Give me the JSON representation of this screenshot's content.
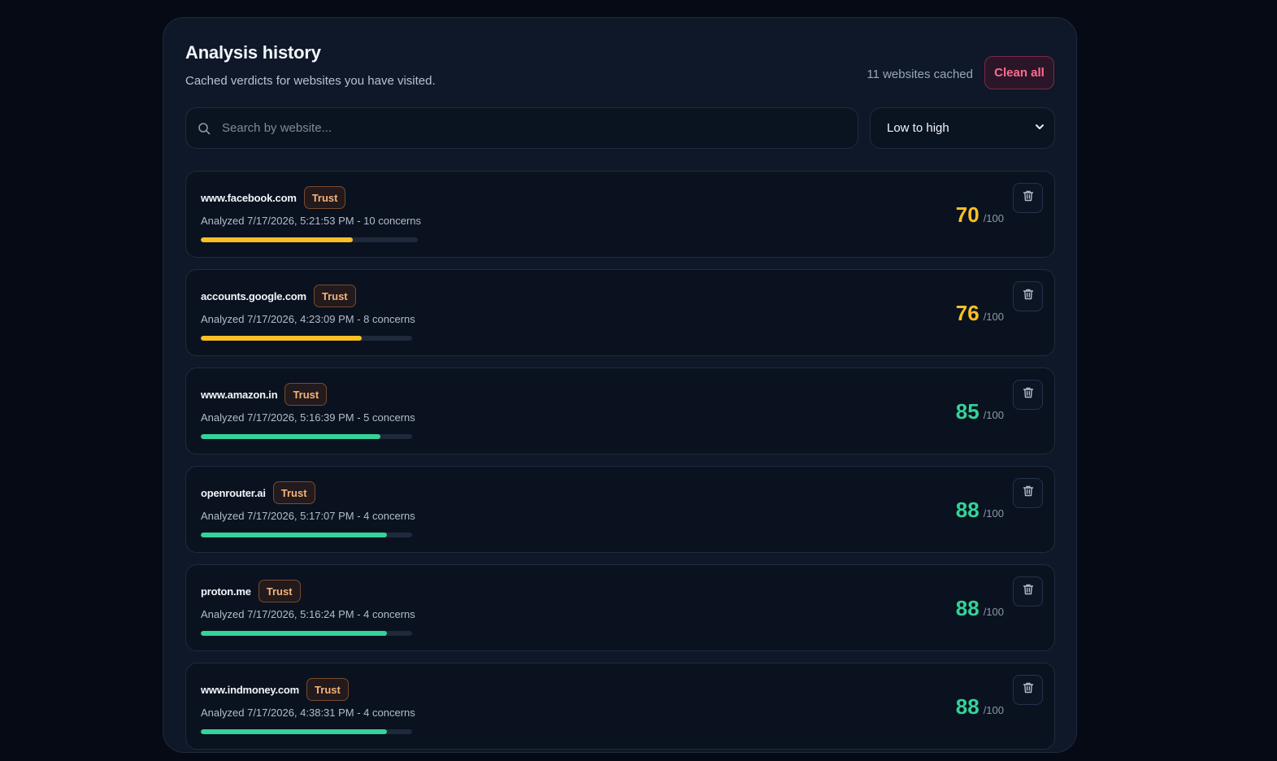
{
  "header": {
    "title": "Analysis history",
    "subtitle": "Cached verdicts for websites you have visited.",
    "cached_count": "11 websites cached",
    "clean_all_label": "Clean all"
  },
  "search": {
    "placeholder": "Search by website...",
    "value": "",
    "icon": "search-icon"
  },
  "sort": {
    "selected": "Low to high",
    "icon": "chevron-down-icon"
  },
  "colors": {
    "warning": "#fbbf24",
    "good": "#34d399",
    "danger": "#ff6b8d",
    "badge_text": "#f5b37a"
  },
  "history": [
    {
      "site": "www.facebook.com",
      "badge": "Trust",
      "meta": "Analyzed 7/17/2026, 5:21:53 PM - 10 concerns",
      "score": "70",
      "max": "/100",
      "score_fraction": 0.7,
      "status": "warning"
    },
    {
      "site": "accounts.google.com",
      "badge": "Trust",
      "meta": "Analyzed 7/17/2026, 4:23:09 PM - 8 concerns",
      "score": "76",
      "max": "/100",
      "score_fraction": 0.76,
      "status": "warning"
    },
    {
      "site": "www.amazon.in",
      "badge": "Trust",
      "meta": "Analyzed 7/17/2026, 5:16:39 PM - 5 concerns",
      "score": "85",
      "max": "/100",
      "score_fraction": 0.85,
      "status": "good"
    },
    {
      "site": "openrouter.ai",
      "badge": "Trust",
      "meta": "Analyzed 7/17/2026, 5:17:07 PM - 4 concerns",
      "score": "88",
      "max": "/100",
      "score_fraction": 0.88,
      "status": "good"
    },
    {
      "site": "proton.me",
      "badge": "Trust",
      "meta": "Analyzed 7/17/2026, 5:16:24 PM - 4 concerns",
      "score": "88",
      "max": "/100",
      "score_fraction": 0.88,
      "status": "good"
    },
    {
      "site": "www.indmoney.com",
      "badge": "Trust",
      "meta": "Analyzed 7/17/2026, 4:38:31 PM - 4 concerns",
      "score": "88",
      "max": "/100",
      "score_fraction": 0.88,
      "status": "good"
    }
  ]
}
